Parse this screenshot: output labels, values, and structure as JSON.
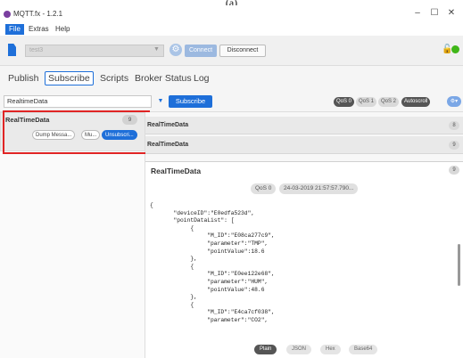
{
  "caption": "(a)",
  "window": {
    "title": "MQTT.fx - 1.2.1"
  },
  "menu": [
    "File",
    "Extras",
    "Help"
  ],
  "toolbar": {
    "profile": "test3",
    "connect_label": "Connect",
    "disconnect_label": "Disconnect"
  },
  "tabs": [
    "Publish",
    "Subscribe",
    "Scripts",
    "Broker Status",
    "Log"
  ],
  "subscribe": {
    "topic_value": "RealtimeData",
    "subscribe_label": "Subscribe",
    "qos": [
      "QoS 0",
      "QoS 1",
      "QoS 2"
    ],
    "autoscroll_label": "Autoscroll",
    "settings_label": "⚙▾"
  },
  "subscription": {
    "topic": "RealTimeData",
    "count": "9",
    "buttons": [
      "Dump Messa...",
      "Mu...",
      "Unsubscri..."
    ]
  },
  "messages": [
    {
      "topic": "RealTimeData",
      "count": "8"
    },
    {
      "topic": "RealTimeData",
      "count": "9"
    }
  ],
  "detail": {
    "topic": "RealTimeData",
    "count": "9",
    "qos": "QoS 0",
    "timestamp": "24-03-2019 21:57:57.790...",
    "payload": "{\n       \"deviceID\":\"E0edfa523d\",\n       \"pointDataList\": [\n            {\n                 \"M_ID\":\"E08ca277c9\",\n                 \"parameter\":\"TMP\",\n                 \"pointValue\":18.6\n            },\n            {\n                 \"M_ID\":\"E0ee122e68\",\n                 \"parameter\":\"HUM\",\n                 \"pointValue\":48.6\n            },\n            {\n                 \"M_ID\":\"E4ca7cf038\",\n                 \"parameter\":\"CO2\","
  },
  "formats": [
    "Plain",
    "JSON",
    "Hex",
    "Base64"
  ],
  "colors": {
    "accent": "#1e6fd9",
    "highlight": "#e02424",
    "status_ok": "#3fb618"
  }
}
